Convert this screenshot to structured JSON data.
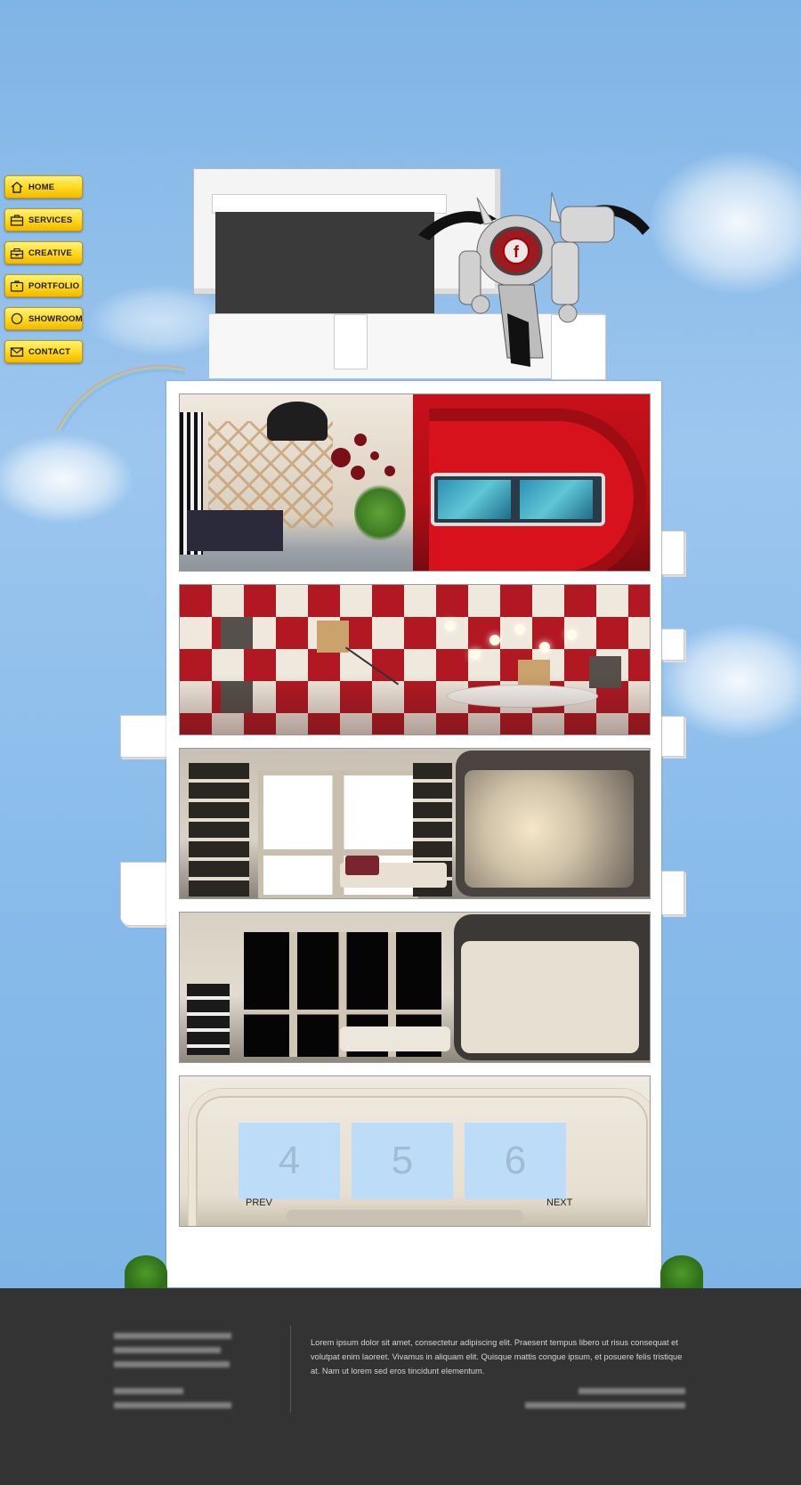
{
  "nav": {
    "items": [
      {
        "label": "HOME",
        "icon": "home-icon"
      },
      {
        "label": "SERVICES",
        "icon": "briefcase-icon"
      },
      {
        "label": "CREATIVE",
        "icon": "toolbox-icon"
      },
      {
        "label": "PORTFOLIO",
        "icon": "portfolio-icon"
      },
      {
        "label": "SHOWROOM",
        "icon": "compass-icon"
      },
      {
        "label": "CONTACT",
        "icon": "envelope-icon"
      }
    ]
  },
  "logo": {
    "letter": "f"
  },
  "gallery": {
    "slots": [
      "4",
      "5",
      "6"
    ],
    "prev_label": "PREV",
    "next_label": "NEXT"
  },
  "footer": {
    "text": "Lorem ipsum dolor sit amet, consectetur adipiscing elit. Praesent tempus libero ut risus consequat et volutpat enim laoreet. Vivamus in aliquam elit. Quisque mattis congue ipsum, et posuere felis tristique at. Nam ut lorem sed eros tincidunt elementum."
  },
  "colors": {
    "sky": "#88bbea",
    "nav_yellow": "#ffd81a",
    "footer_bg": "#333333",
    "accent_red": "#c8101a"
  }
}
